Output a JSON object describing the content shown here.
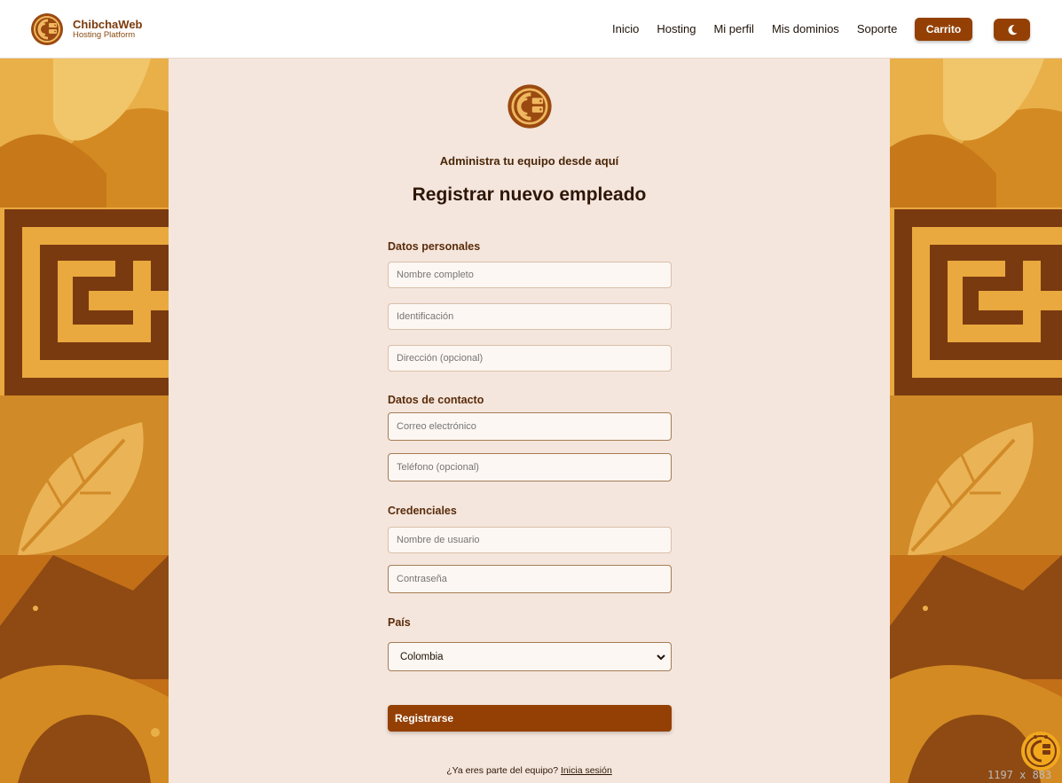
{
  "header": {
    "brand_name": "ChibchaWeb",
    "brand_subtitle": "Hosting Platform",
    "nav": [
      "Inicio",
      "Hosting",
      "Mi perfil",
      "Mis dominios",
      "Soporte"
    ],
    "cart_label": "Carrito",
    "theme_icon": "moon-icon"
  },
  "main": {
    "tagline": "Administra tu equipo desde aquí",
    "title": "Registrar nuevo empleado",
    "sections": {
      "personal": "Datos personales",
      "contact": "Datos de contacto",
      "credentials": "Credenciales",
      "country": "País"
    },
    "fields": {
      "full_name": "Nombre completo",
      "identification": "Identificación",
      "address": "Dirección (opcional)",
      "email": "Correo electrónico",
      "phone": "Teléfono (opcional)",
      "username": "Nombre de usuario",
      "password": "Contraseña"
    },
    "country_selected": "Colombia",
    "submit_label": "Registrarse",
    "login_prompt": "¿Ya eres parte del equipo?",
    "login_link": "Inicia sesión"
  },
  "overlay": {
    "dimensions": "1197 x 883"
  },
  "colors": {
    "brand": "#944005",
    "panel_bg": "#f4e6dd",
    "side_gold": "#d9952a",
    "side_dark": "#8e4a12"
  }
}
